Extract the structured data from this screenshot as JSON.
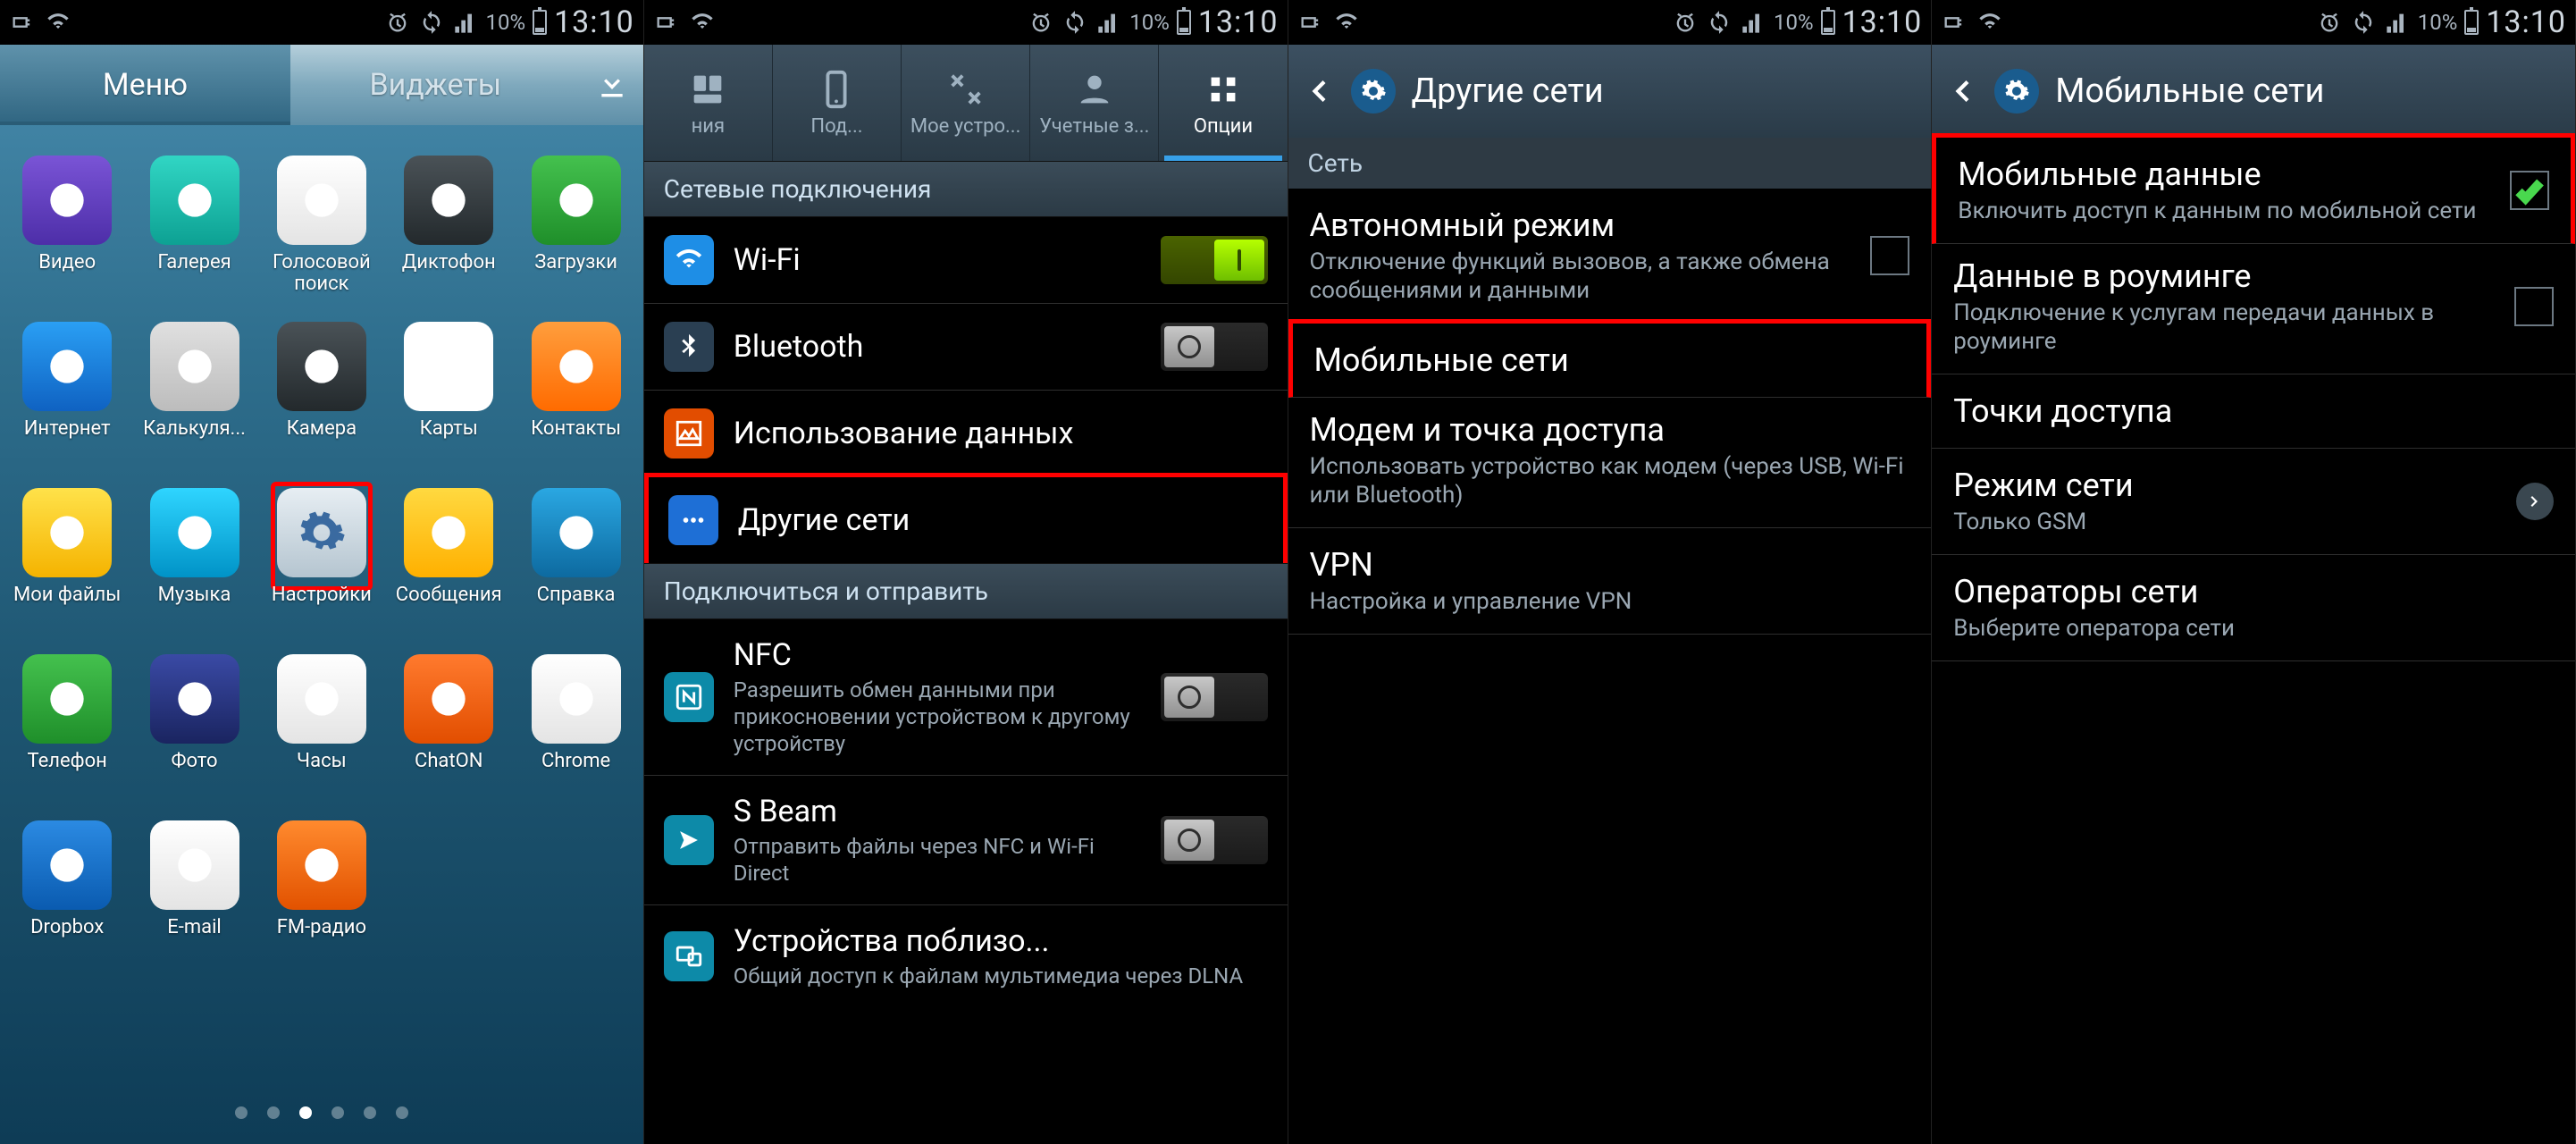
{
  "statusbar": {
    "battery_pct": "10%",
    "time": "13:10"
  },
  "s1": {
    "tabs": {
      "menu": "Меню",
      "widgets": "Виджеты"
    },
    "apps": [
      {
        "label": "Видео",
        "bg": "bg-purple"
      },
      {
        "label": "Галерея",
        "bg": "bg-teal"
      },
      {
        "label": "Голосовой поиск",
        "bg": "bg-white"
      },
      {
        "label": "Диктофон",
        "bg": "bg-darkg"
      },
      {
        "label": "Загрузки",
        "bg": "bg-green"
      },
      {
        "label": "Интернет",
        "bg": "bg-blue"
      },
      {
        "label": "Калькуля...",
        "bg": "bg-gray"
      },
      {
        "label": "Камера",
        "bg": "bg-darkg"
      },
      {
        "label": "Карты",
        "bg": "bg-google"
      },
      {
        "label": "Контакты",
        "bg": "bg-orange"
      },
      {
        "label": "Мои файлы",
        "bg": "bg-yellow"
      },
      {
        "label": "Музыка",
        "bg": "bg-cyan"
      },
      {
        "label": "Настройки",
        "bg": "bg-gear",
        "highlight": true
      },
      {
        "label": "Сообщения",
        "bg": "bg-mail"
      },
      {
        "label": "Справка",
        "bg": "bg-help"
      },
      {
        "label": "Телефон",
        "bg": "bg-green"
      },
      {
        "label": "Фото",
        "bg": "bg-dblue"
      },
      {
        "label": "Часы",
        "bg": "bg-white"
      },
      {
        "label": "ChatON",
        "bg": "bg-chaton"
      },
      {
        "label": "Chrome",
        "bg": "bg-white"
      },
      {
        "label": "Dropbox",
        "bg": "bg-dbox"
      },
      {
        "label": "E-mail",
        "bg": "bg-white"
      },
      {
        "label": "FM-радио",
        "bg": "bg-radio"
      }
    ]
  },
  "s2": {
    "tabs": {
      "t1": "ния",
      "t2": "Под...",
      "t3": "Мое устро...",
      "t4": "Учетные з...",
      "t5": "Опции"
    },
    "hdr1": "Сетевые подключения",
    "wifi": "Wi-Fi",
    "bt": "Bluetooth",
    "data": "Использование данных",
    "more": "Другие сети",
    "hdr2": "Подключиться и отправить",
    "nfc": {
      "t": "NFC",
      "s": "Разрешить обмен данными при прикосновении устройством к другому устройству"
    },
    "sbeam": {
      "t": "S Beam",
      "s": "Отправить файлы через NFC и Wi-Fi Direct"
    },
    "nearby": {
      "t": "Устройства поблизо...",
      "s": "Общий доступ к файлам мультимедиа через DLNA"
    }
  },
  "s3": {
    "title": "Другие сети",
    "hdr": "Сеть",
    "airplane": {
      "t": "Автономный режим",
      "s": "Отключение функций вызовов, а также обмена сообщениями и данными"
    },
    "mobile": "Мобильные сети",
    "tether": {
      "t": "Модем и точка доступа",
      "s": "Использовать устройство как модем (через USB, Wi-Fi или Bluetooth)"
    },
    "vpn": {
      "t": "VPN",
      "s": "Настройка и управление VPN"
    }
  },
  "s4": {
    "title": "Мобильные сети",
    "mdata": {
      "t": "Мобильные данные",
      "s": "Включить доступ к данным по мобильной сети"
    },
    "roam": {
      "t": "Данные в роуминге",
      "s": "Подключение к услугам передачи данных в роуминге"
    },
    "apn": "Точки доступа",
    "mode": {
      "t": "Режим сети",
      "s": "Только GSM"
    },
    "ops": {
      "t": "Операторы сети",
      "s": "Выберите оператора сети"
    }
  }
}
